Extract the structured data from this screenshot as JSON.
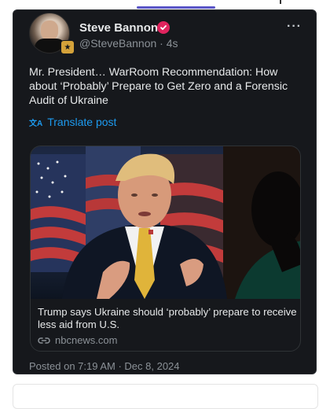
{
  "author": {
    "name": "Steve Bannon",
    "handle": "@SteveBannon",
    "time_ago": "4s"
  },
  "post": {
    "text": "Mr. President… WarRoom Recommendation: How about ‘Probably’ Prepare to Get Zero and a Forensic Audit of Ukraine",
    "translate_label": "Translate post"
  },
  "link_card": {
    "headline": "Trump says Ukraine should ‘probably’ prepare to receive less aid from U.S.",
    "domain": "nbcnews.com"
  },
  "timestamp": "Posted on 7:19 AM · Dec 8, 2024",
  "icons": {
    "more": "more-options-icon",
    "verified": "verified-badge-icon",
    "translate": "translate-icon",
    "link": "link-icon"
  },
  "colors": {
    "card_background": "#16181c",
    "accent": "#1d9bf0",
    "verified": "#e0245e",
    "text_primary": "#e7e9ea",
    "text_secondary": "#8b9197"
  }
}
